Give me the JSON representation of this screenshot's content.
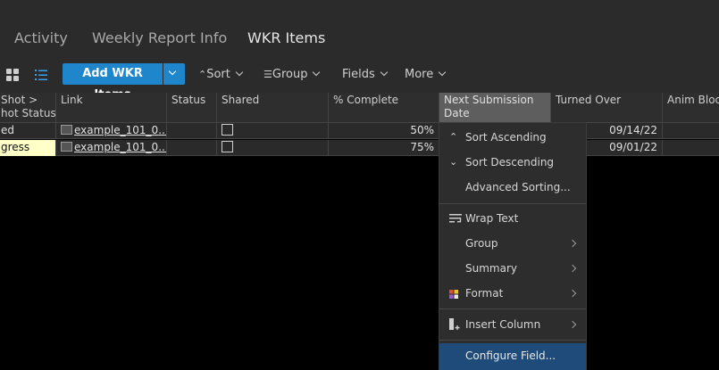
{
  "tabs": [
    {
      "label": "Activity"
    },
    {
      "label": "Weekly Report Info"
    },
    {
      "label": "WKR Items",
      "active": true
    }
  ],
  "toolbar": {
    "add_label": "Add WKR Items",
    "sort_label": "Sort",
    "group_label": "Group",
    "fields_label": "Fields",
    "more_label": "More"
  },
  "columns": [
    {
      "line1": "Shot >",
      "line2": "hot Status"
    },
    {
      "line1": "Link",
      "line2": ""
    },
    {
      "line1": "Status",
      "line2": ""
    },
    {
      "line1": "Shared",
      "line2": ""
    },
    {
      "line1": "% Complete",
      "line2": ""
    },
    {
      "line1": "Next Submission",
      "line2": "Date"
    },
    {
      "line1": "Turned Over",
      "line2": ""
    },
    {
      "line1": "Anim Block",
      "line2": ""
    }
  ],
  "rows": [
    {
      "shot_status": "ed",
      "link": "example_101_0...",
      "status": "",
      "pct": "50%",
      "turned_over": "09/14/22"
    },
    {
      "shot_status": "gress",
      "link": "example_101_0...",
      "status": "",
      "pct": "75%",
      "turned_over": "09/01/22"
    }
  ],
  "menu": {
    "sort_asc": "Sort Ascending",
    "sort_desc": "Sort Descending",
    "advanced_sorting": "Advanced Sorting...",
    "wrap_text": "Wrap Text",
    "group": "Group",
    "summary": "Summary",
    "format": "Format",
    "insert_column": "Insert Column",
    "configure_field": "Configure Field..."
  },
  "colors": {
    "accent": "#1f86cc",
    "highlight": "#1e4b7a",
    "yellow_cell": "#ffffc8"
  }
}
